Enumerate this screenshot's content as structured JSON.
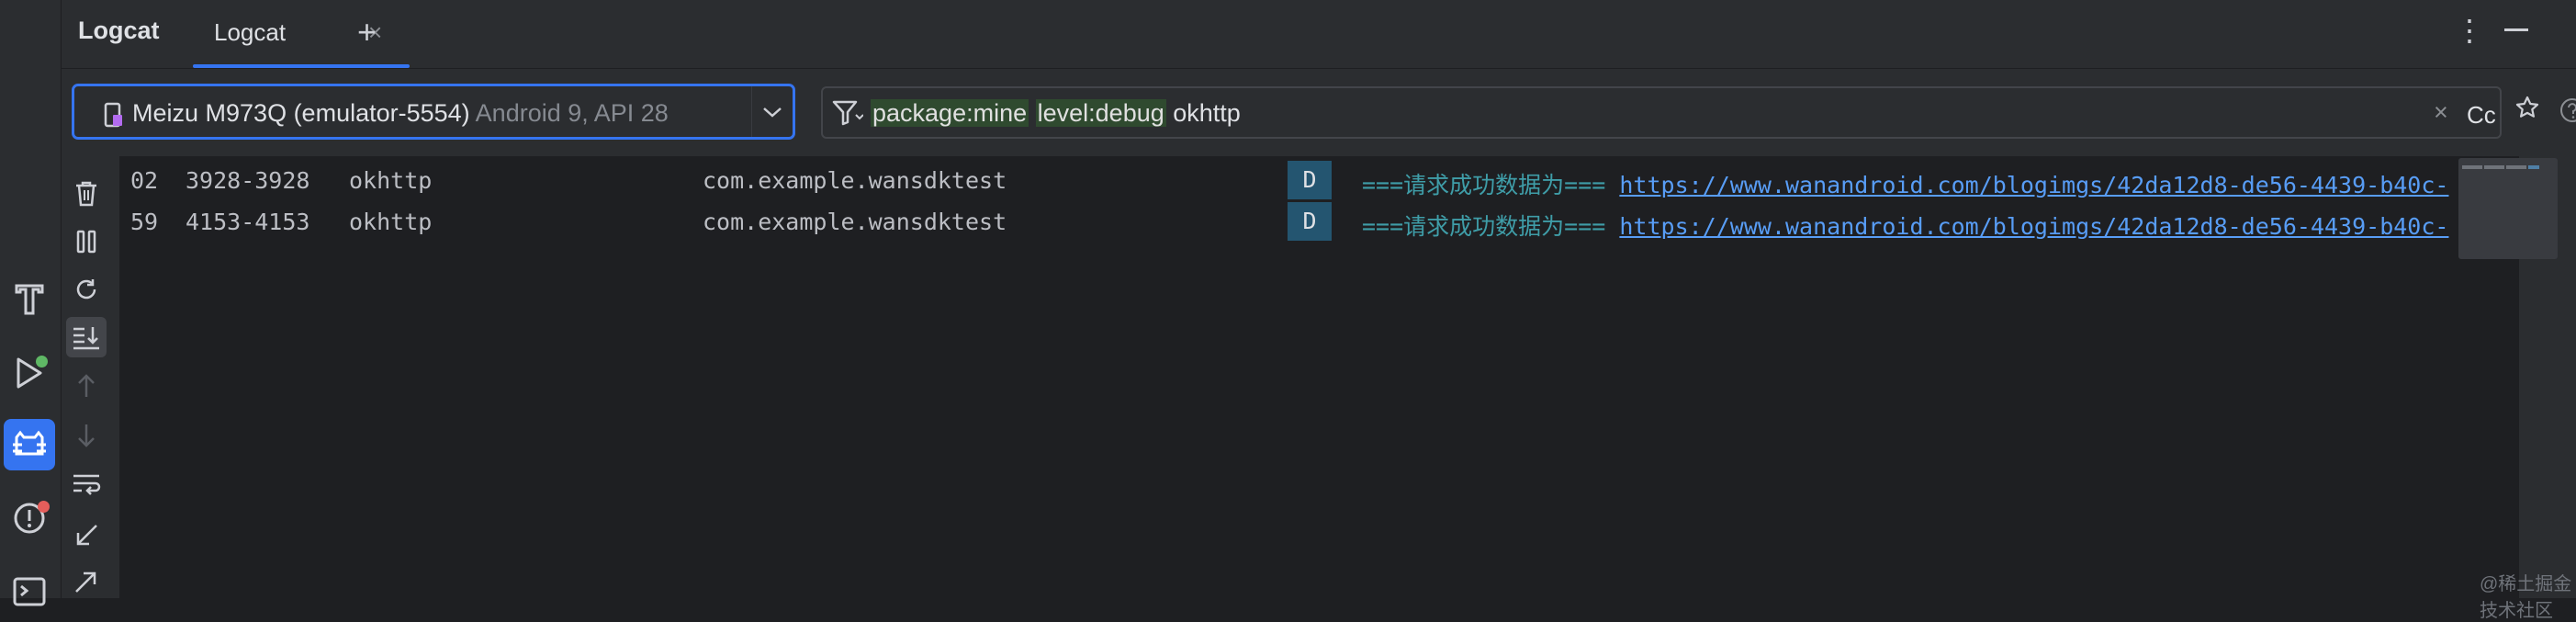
{
  "header": {
    "title": "Logcat",
    "tab_label": "Logcat",
    "tab_close": "×",
    "add_tab": "+",
    "more": "⋮"
  },
  "device_selector": {
    "device_name": "Meizu M973Q (emulator-5554)",
    "api": "Android 9, API 28"
  },
  "filter": {
    "tokens": [
      "package:mine",
      "level:debug"
    ],
    "text": "okhttp",
    "clear": "×",
    "match_case": "Cc"
  },
  "log_rows": [
    {
      "time_tail": "02",
      "pid_tid": "3928-3928",
      "tag": "okhttp",
      "package": "com.example.wansdktest",
      "level": "D",
      "message": "===请求成功数据为===",
      "url": "https://www.wanandroid.com/blogimgs/42da12d8-de56-4439-b40c-"
    },
    {
      "time_tail": "59",
      "pid_tid": "4153-4153",
      "tag": "okhttp",
      "package": "com.example.wansdktest",
      "level": "D",
      "message": "===请求成功数据为===",
      "url": "https://www.wanandroid.com/blogimgs/42da12d8-de56-4439-b40c-"
    }
  ],
  "watermark": "@稀土掘金技术社区",
  "colors": {
    "accent": "#3574f0",
    "level_debug_bg": "#245570",
    "message": "#3f9da8",
    "link": "#589df6",
    "filter_highlight": "#2f4a2f"
  }
}
